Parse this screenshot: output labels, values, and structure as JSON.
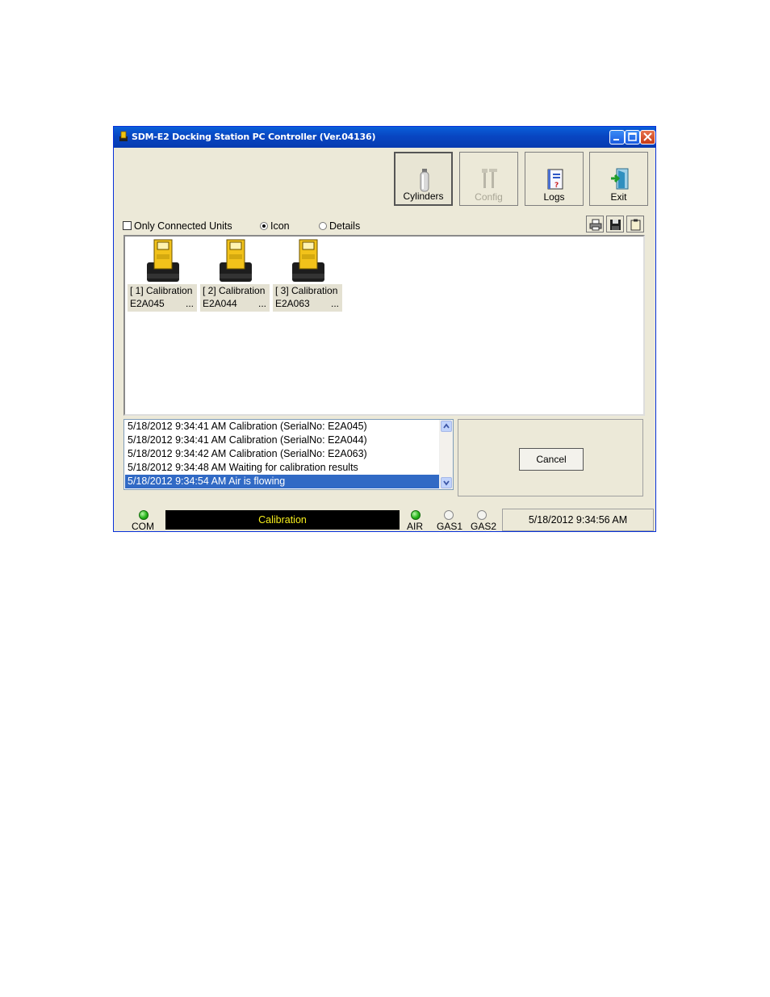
{
  "window": {
    "title": "SDM-E2 Docking Station PC Controller (Ver.04136)",
    "title_icon": "docking-station-icon"
  },
  "toolbar": {
    "buttons": [
      {
        "label": "Cylinders",
        "icon": "gas-cylinder-icon",
        "state": "pressed"
      },
      {
        "label": "Config",
        "icon": "tools-icon",
        "state": "disabled"
      },
      {
        "label": "Logs",
        "icon": "logbook-icon",
        "state": "normal"
      },
      {
        "label": "Exit",
        "icon": "exit-door-icon",
        "state": "normal"
      }
    ]
  },
  "options": {
    "only_connected_label": "Only Connected Units",
    "only_connected_checked": false,
    "view_icon_label": "Icon",
    "view_details_label": "Details",
    "selected_view": "Icon"
  },
  "units": [
    {
      "line1": "[ 1] Calibration",
      "serial": "E2A045",
      "more": "..."
    },
    {
      "line1": "[ 2] Calibration",
      "serial": "E2A044",
      "more": "..."
    },
    {
      "line1": "[ 3] Calibration",
      "serial": "E2A063",
      "more": "..."
    }
  ],
  "log": [
    "5/18/2012 9:34:41 AM Calibration (SerialNo: E2A045)",
    "5/18/2012 9:34:41 AM Calibration (SerialNo: E2A044)",
    "5/18/2012 9:34:42 AM Calibration (SerialNo: E2A063)",
    "5/18/2012 9:34:48 AM Waiting for calibration results",
    "5/18/2012 9:34:54 AM Air is flowing"
  ],
  "log_selected_index": 4,
  "actions": {
    "cancel_label": "Cancel"
  },
  "status": {
    "com_label": "COM",
    "com_on": true,
    "display_text": "Calibration",
    "air_label": "AIR",
    "air_on": true,
    "gas1_label": "GAS1",
    "gas1_on": false,
    "gas2_label": "GAS2",
    "gas2_on": false,
    "datetime": "5/18/2012 9:34:56 AM"
  },
  "colors": {
    "titlebar": "#0846c2",
    "selection": "#316ac5",
    "display_text": "#f6ee1c",
    "led_on": "#26b51a"
  }
}
